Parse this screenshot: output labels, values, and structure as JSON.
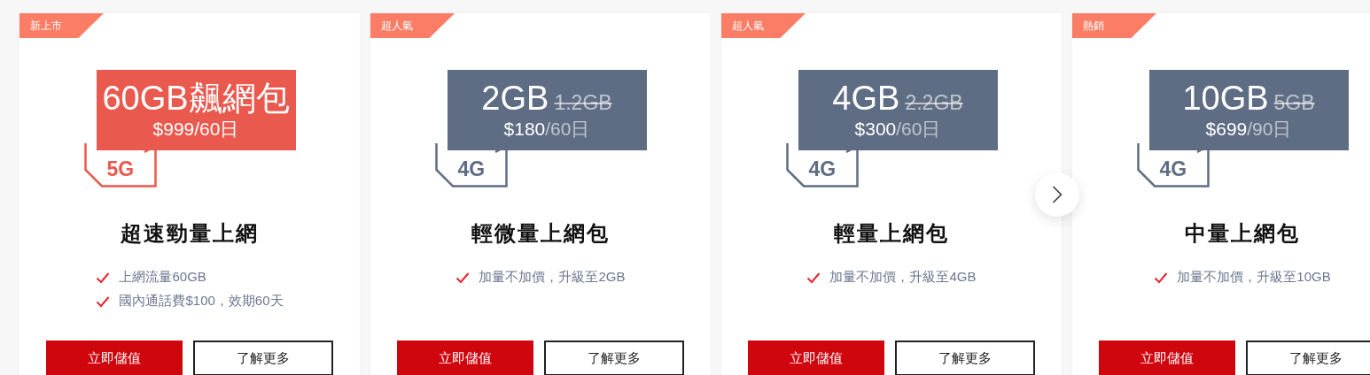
{
  "plans": [
    {
      "badge": "新上市",
      "kind": "featured",
      "amount": "60GB飆網包",
      "price": "$999",
      "period": "/60日",
      "network": "5G",
      "title": "超速勁量上網",
      "features": [
        "上網流量60GB",
        "國內通話費$100，效期60天"
      ],
      "buttons": [
        "立即儲值",
        "了解更多"
      ]
    },
    {
      "badge": "超人氣",
      "kind": "standard",
      "amount": "2GB",
      "old_amount": "1.2GB",
      "price": "$180",
      "period": "/60日",
      "network": "4G",
      "title": "輕微量上網包",
      "features": [
        "加量不加價，升級至2GB"
      ],
      "buttons": [
        "立即儲值",
        "了解更多"
      ]
    },
    {
      "badge": "超人氣",
      "kind": "standard",
      "amount": "4GB",
      "old_amount": "2.2GB",
      "price": "$300",
      "period": "/60日",
      "network": "4G",
      "title": "輕量上網包",
      "features": [
        "加量不加價，升級至4GB"
      ],
      "buttons": [
        "立即儲值",
        "了解更多"
      ]
    },
    {
      "badge": "熱銷",
      "kind": "standard",
      "amount": "10GB",
      "old_amount": "5GB",
      "price": "$699",
      "period": "/90日",
      "network": "4G",
      "title": "中量上網包",
      "features": [
        "加量不加價，升級至10GB"
      ],
      "buttons": [
        "立即儲值",
        "了解更多"
      ]
    }
  ]
}
